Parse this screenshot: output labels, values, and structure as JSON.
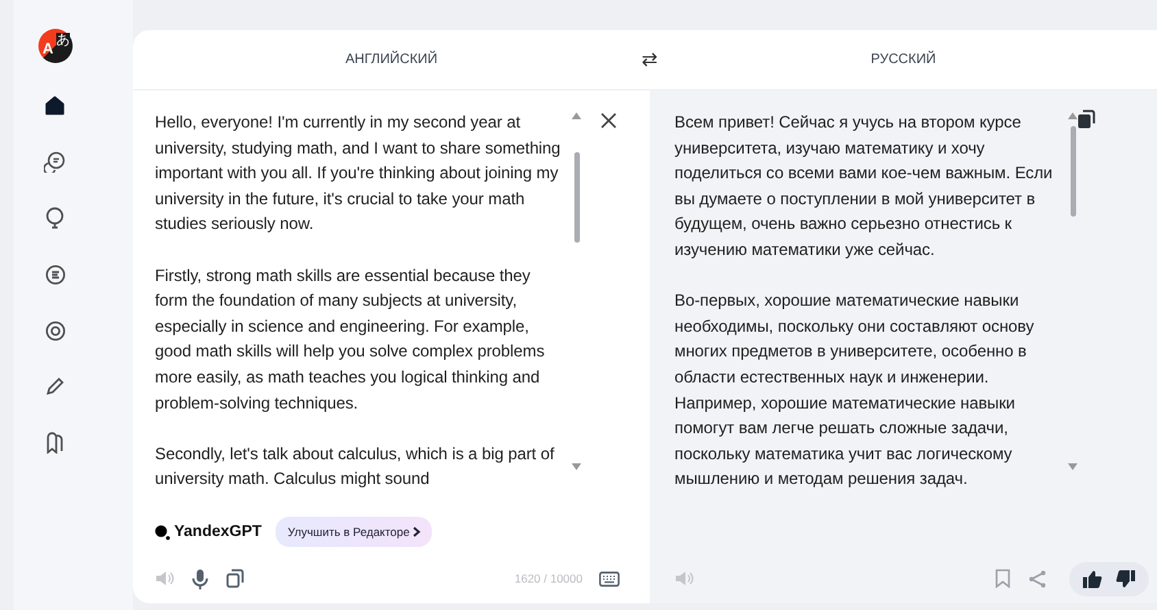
{
  "logo": {
    "letters": [
      "A",
      "あ"
    ]
  },
  "sidebar": {
    "items": [
      {
        "selected": true
      },
      {
        "selected": false
      },
      {
        "selected": false
      },
      {
        "selected": false
      },
      {
        "selected": false
      },
      {
        "selected": false
      },
      {
        "selected": false
      }
    ]
  },
  "header": {
    "source_language": "АНГЛИЙСКИЙ",
    "swap": "⇄",
    "target_language": "РУССКИЙ"
  },
  "source": {
    "paragraphs": [
      "Hello, everyone! I'm currently in my second year at university, studying math, and I want to share something important with you all. If you're thinking about joining my university in the future, it's crucial to take your math studies seriously now.",
      "Firstly, strong math skills are essential because they form the foundation of many subjects at university, especially in science and engineering. For example, good math skills will help you solve complex problems more easily, as math teaches you logical thinking and problem-solving techniques.",
      "Secondly, let's talk about calculus, which is a big part of university math. Calculus might sound"
    ],
    "model": "YandexGPT",
    "improve_button": "Улучшить в Редакторе",
    "counter": "1620 / 10000"
  },
  "target": {
    "paragraphs": [
      "Всем привет! Сейчас я учусь на втором курсе университета, изучаю математику и хочу поделиться со всеми вами кое-чем важным. Если вы думаете о поступлении в мой университет в будущем, очень важно серьезно отнестись к изучению математики уже сейчас.",
      "Во-первых, хорошие математические навыки необходимы, поскольку они составляют основу многих предметов в университете, особенно в области естественных наук и инженерии. Например, хорошие математические навыки помогут вам легче решать сложные задачи, поскольку математика учит вас логическому мышлению и методам решения задач."
    ]
  }
}
